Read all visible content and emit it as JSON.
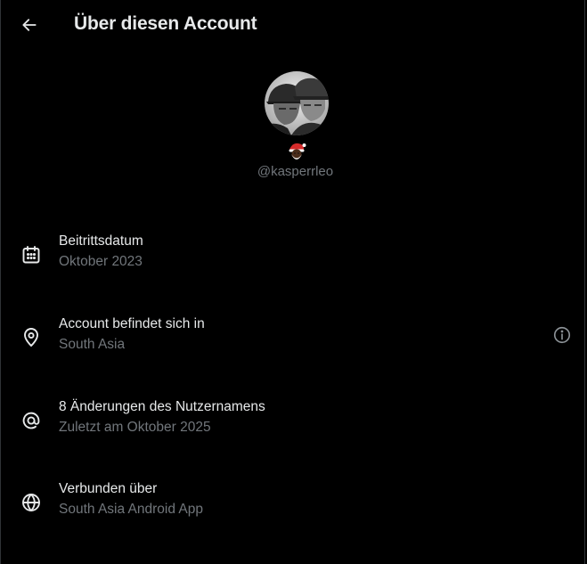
{
  "header": {
    "title": "Über diesen Account",
    "back_icon": "arrow-left-icon"
  },
  "profile": {
    "display_name_emoji": "🎅🏿",
    "handle": "@kasperrleo"
  },
  "rows": [
    {
      "icon": "calendar-icon",
      "title": "Beitrittsdatum",
      "subtitle": "Oktober 2023"
    },
    {
      "icon": "location-pin-icon",
      "title": "Account befindet sich in",
      "subtitle": "South Asia",
      "info_icon": "info-circle-icon"
    },
    {
      "icon": "at-sign-icon",
      "title": "8 Änderungen des Nutzernamens",
      "subtitle": "Zuletzt am Oktober 2025"
    },
    {
      "icon": "globe-icon",
      "title": "Verbunden über",
      "subtitle": "South Asia Android App"
    }
  ],
  "colors": {
    "background": "#000000",
    "primary_text": "#e7e9ea",
    "secondary_text": "#71767b",
    "border": "#2f3336"
  }
}
